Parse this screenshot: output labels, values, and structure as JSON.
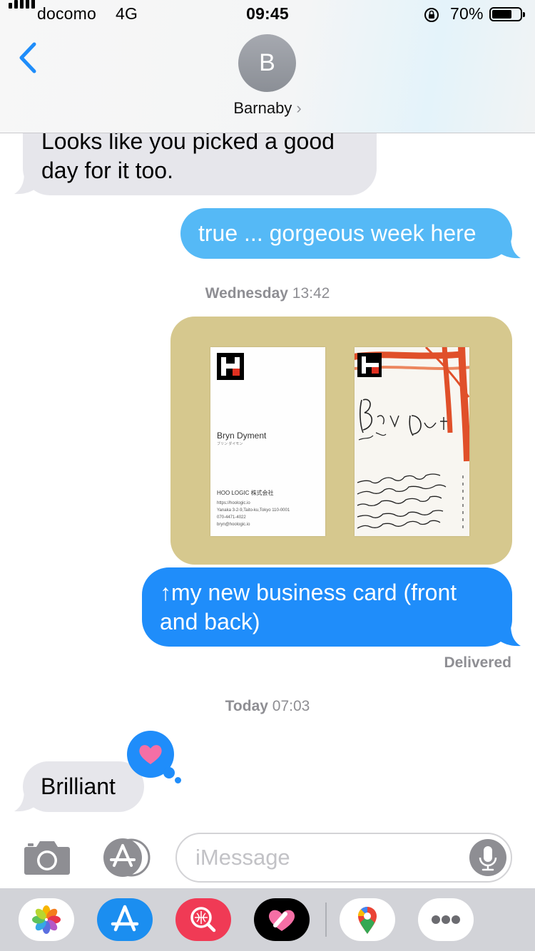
{
  "status": {
    "carrier": "docomo",
    "network": "4G",
    "time": "09:45",
    "battery": "70%"
  },
  "header": {
    "avatar_initial": "B",
    "contact_name": "Barnaby",
    "chevron": "›"
  },
  "messages": [
    {
      "from": "them",
      "text_line1": "Looks like you picked a good",
      "text_line2": "day for it too."
    },
    {
      "from": "me",
      "text": "true ... gorgeous week here"
    },
    {
      "from": "me",
      "text_line1": "↑my new business card (front",
      "text_line2": "and back)"
    },
    {
      "from": "them",
      "text": "Brilliant"
    }
  ],
  "timestamps": [
    {
      "day": "Wednesday",
      "time": "13:42"
    },
    {
      "day": "Today",
      "time": "07:03"
    }
  ],
  "delivered": "Delivered",
  "business_card": {
    "name": "Bryn Dyment",
    "kana": "ブリン ダイモン",
    "company": "HOO LOGIC 株式会社",
    "url": "https://hoologic.io",
    "address": "Yanaka 3-2-9,Taito-ku,Tokyo 110-0001",
    "phone": "070-4471-4022",
    "email": "bryn@hoologic.io"
  },
  "compose": {
    "placeholder": "iMessage"
  },
  "icons": {
    "back": "chevron-left-icon",
    "camera": "camera-icon",
    "apps": "app-store-icon",
    "mic": "microphone-icon",
    "reaction": "heart-icon"
  },
  "colors": {
    "sent_bubble": "#1f8dfa",
    "received_bubble": "#e6e6eb",
    "reaction_heart": "#f56fa5"
  }
}
